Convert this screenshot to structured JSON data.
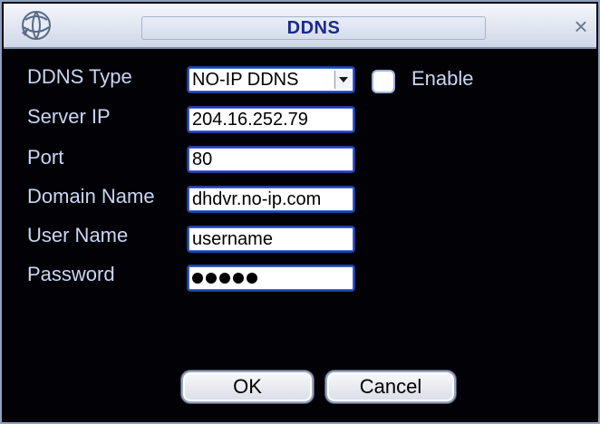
{
  "window": {
    "title": "DDNS",
    "close_glyph": "×"
  },
  "icons": {
    "logo": "globe-logo-icon",
    "close": "close-icon",
    "dropdown": "chevron-down-icon"
  },
  "form": {
    "ddns_type": {
      "label": "DDNS Type",
      "value": "NO-IP DDNS"
    },
    "enable": {
      "label": "Enable",
      "checked": false
    },
    "server_ip": {
      "label": "Server IP",
      "value": "204.16.252.79"
    },
    "port": {
      "label": "Port",
      "value": "80"
    },
    "domain_name": {
      "label": "Domain Name",
      "value": "dhdvr.no-ip.com"
    },
    "user_name": {
      "label": "User Name",
      "value": "username"
    },
    "password": {
      "label": "Password",
      "mask_count": 5
    }
  },
  "buttons": {
    "ok": "OK",
    "cancel": "Cancel"
  },
  "colors": {
    "background": "#020206",
    "label_text": "#c9d6f3",
    "title_text": "#1a2a8a",
    "field_border": "#1f3fa8"
  }
}
